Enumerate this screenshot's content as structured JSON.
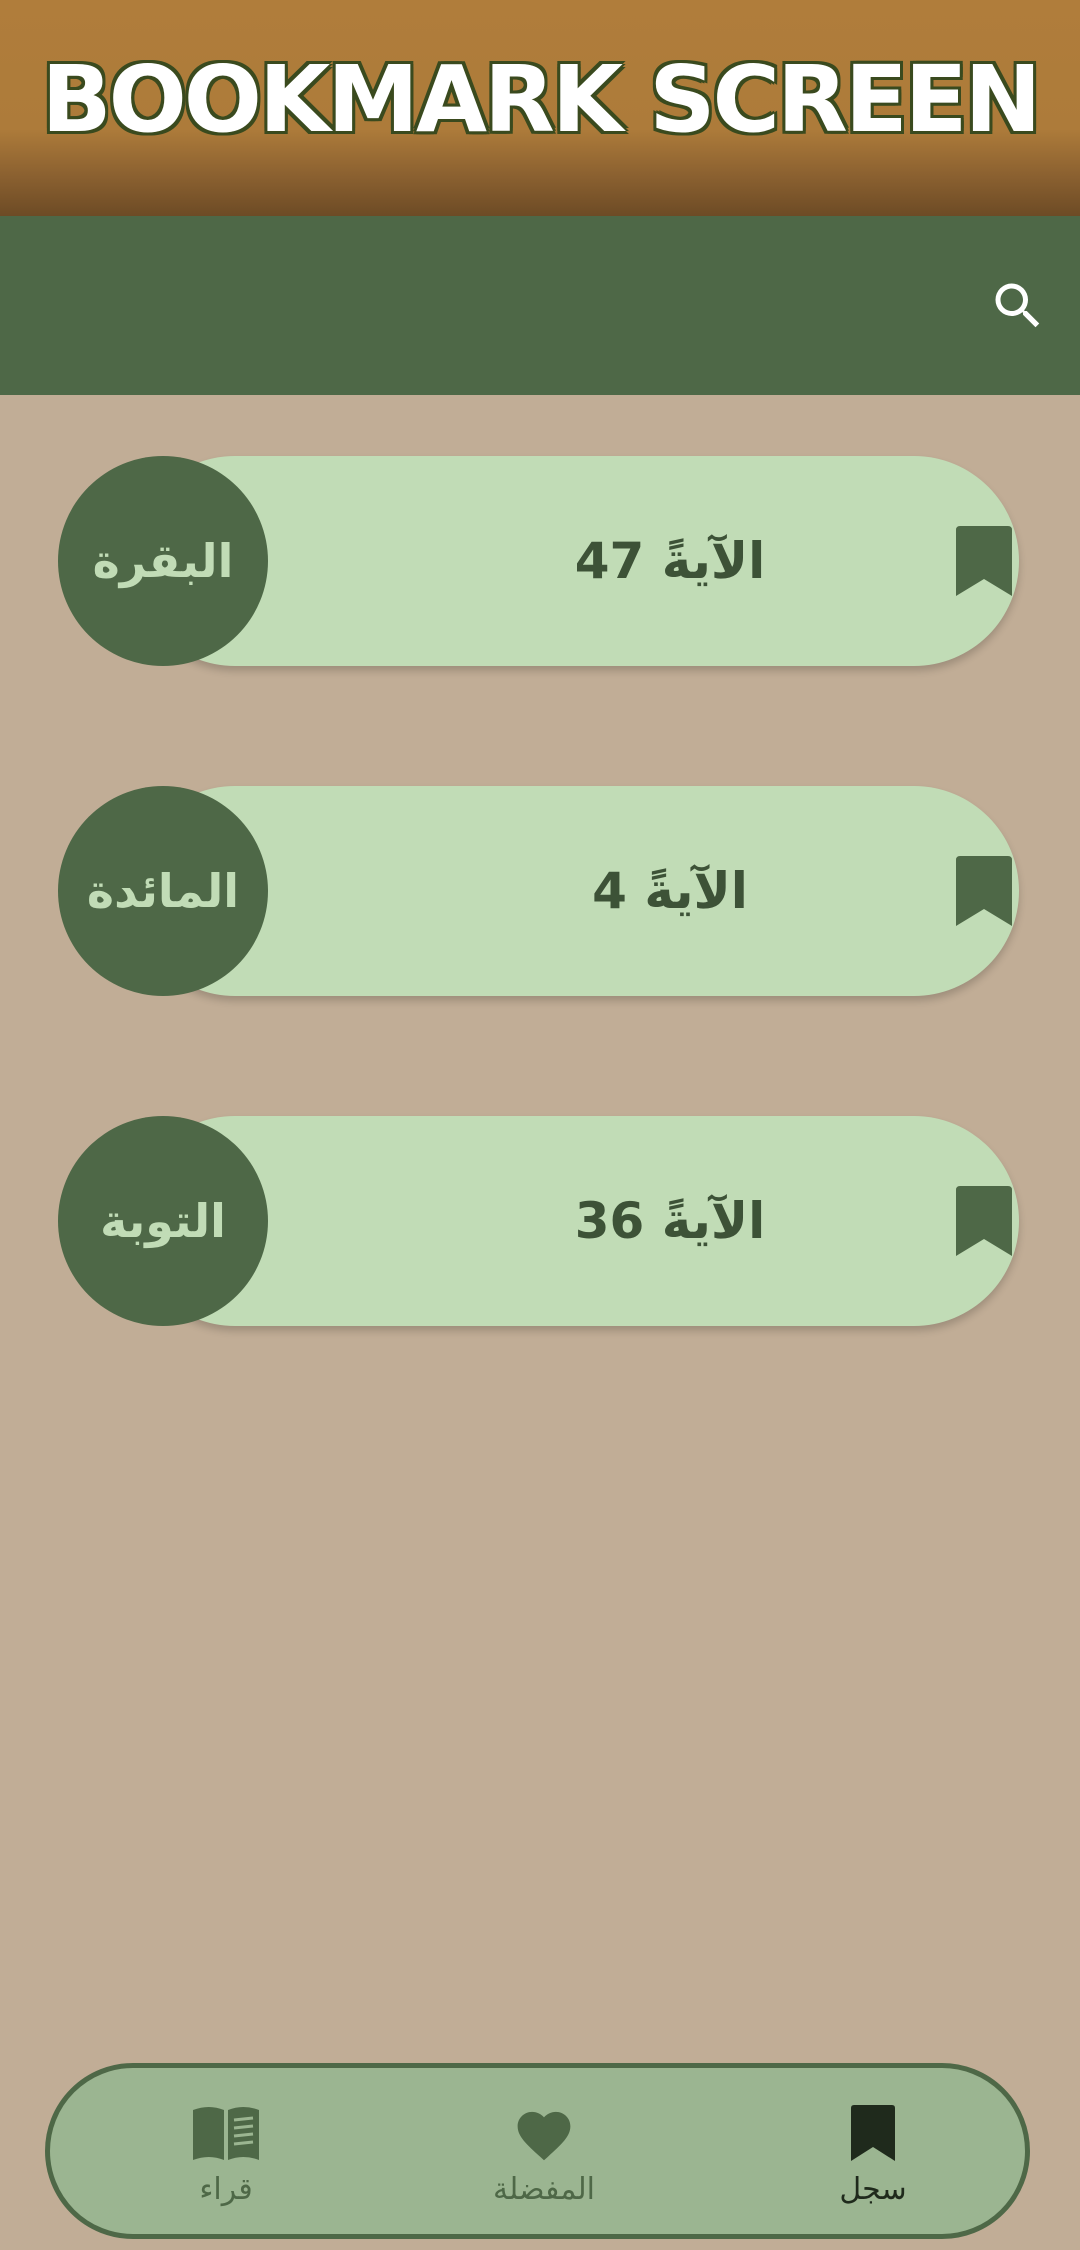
{
  "banner": {
    "title": "BOOKMARK SCREEN"
  },
  "appbar": {
    "search_icon": "search-icon"
  },
  "bookmarks": [
    {
      "surah": "البقرة",
      "ayah": "الآيةً 47",
      "icon": "bookmark-icon"
    },
    {
      "surah": "المائدة",
      "ayah": "الآيةً 4",
      "icon": "bookmark-icon"
    },
    {
      "surah": "التوبة",
      "ayah": "الآيةً 36",
      "icon": "bookmark-icon"
    }
  ],
  "bottom_nav": {
    "items": [
      {
        "label": "قراء",
        "icon": "book-open-icon",
        "active": false
      },
      {
        "label": "المفضلة",
        "icon": "heart-icon",
        "active": false
      },
      {
        "label": "سجل",
        "icon": "bookmark-icon",
        "active": true
      }
    ]
  },
  "colors": {
    "background": "#c1ad96",
    "banner": "#b07d3b",
    "appbar": "#4e6847",
    "card": "#c1dcb6",
    "circle": "#4e6847",
    "nav_bg": "#9bb591",
    "nav_active": "#1f2a1c"
  }
}
